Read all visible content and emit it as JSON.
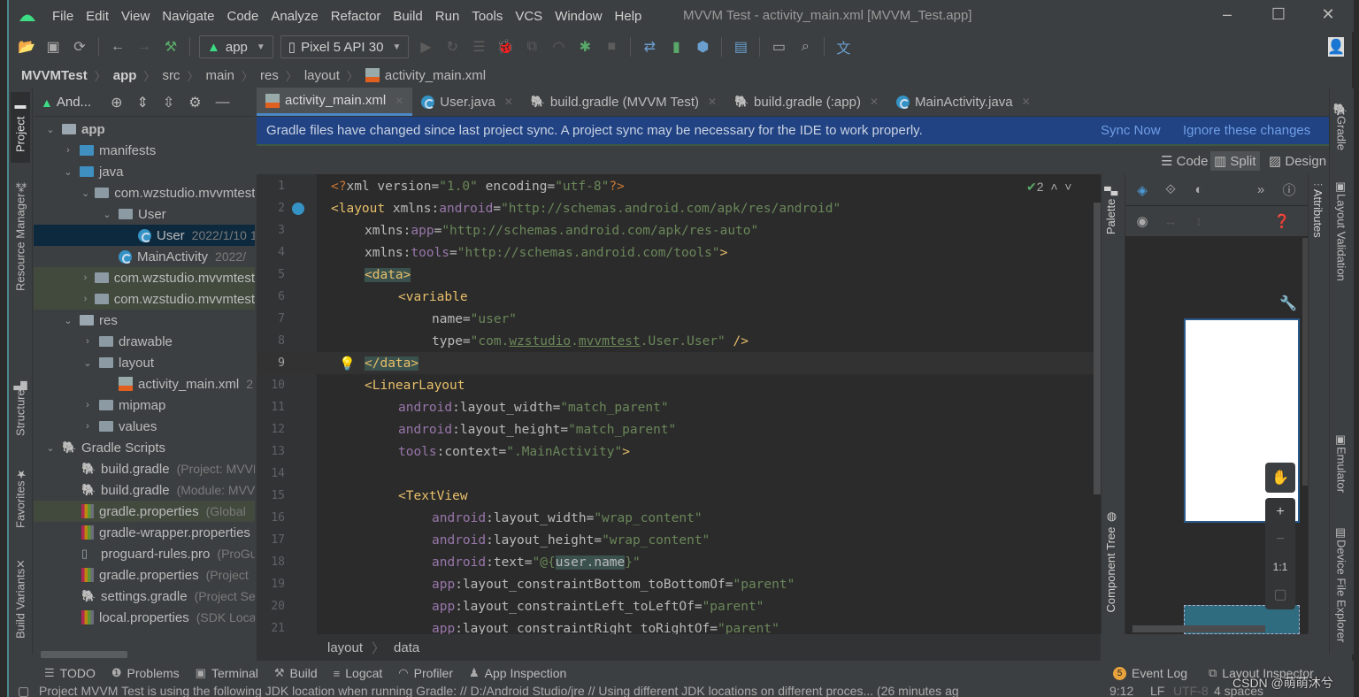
{
  "menu": {
    "items": [
      "File",
      "Edit",
      "View",
      "Navigate",
      "Code",
      "Analyze",
      "Refactor",
      "Build",
      "Run",
      "Tools",
      "VCS",
      "Window",
      "Help"
    ],
    "window_title": "MVVM Test - activity_main.xml [MVVM_Test.app]"
  },
  "window_controls": {
    "minimize": "–",
    "maximize": "☐",
    "close": "✕"
  },
  "toolbar": {
    "run_config": "app",
    "device": "Pixel 5 API 30"
  },
  "breadcrumb": [
    "MVVMTest",
    "app",
    "src",
    "main",
    "res",
    "layout",
    "activity_main.xml"
  ],
  "left_stripe": [
    "Project",
    "Resource Manager",
    "Structure",
    "Favorites",
    "Build Variants"
  ],
  "right_stripe": [
    "Gradle",
    "Layout Validation",
    "Emulator",
    "Device File Explorer"
  ],
  "project": {
    "view_mode": "And...",
    "tree": [
      {
        "label": "app",
        "meta": ""
      },
      {
        "label": "manifests",
        "meta": ""
      },
      {
        "label": "java",
        "meta": ""
      },
      {
        "label": "com.wzstudio.mvvmtest",
        "meta": ""
      },
      {
        "label": "User",
        "meta": ""
      },
      {
        "label": "User",
        "meta": "2022/1/10 1"
      },
      {
        "label": "MainActivity",
        "meta": "2022/"
      },
      {
        "label": "com.wzstudio.mvvmtest",
        "meta": ""
      },
      {
        "label": "com.wzstudio.mvvmtest",
        "meta": ""
      },
      {
        "label": "res",
        "meta": ""
      },
      {
        "label": "drawable",
        "meta": ""
      },
      {
        "label": "layout",
        "meta": ""
      },
      {
        "label": "activity_main.xml",
        "meta": "2"
      },
      {
        "label": "mipmap",
        "meta": ""
      },
      {
        "label": "values",
        "meta": ""
      },
      {
        "label": "Gradle Scripts",
        "meta": ""
      },
      {
        "label": "build.gradle",
        "meta": "(Project: MVVM"
      },
      {
        "label": "build.gradle",
        "meta": "(Module: MVVM"
      },
      {
        "label": "gradle.properties",
        "meta": "(Global"
      },
      {
        "label": "gradle-wrapper.properties",
        "meta": ""
      },
      {
        "label": "proguard-rules.pro",
        "meta": "(ProGuard"
      },
      {
        "label": "gradle.properties",
        "meta": "(Project"
      },
      {
        "label": "settings.gradle",
        "meta": "(Project Se"
      },
      {
        "label": "local.properties",
        "meta": "(SDK Loca"
      }
    ]
  },
  "tabs": [
    {
      "label": "activity_main.xml",
      "active": true
    },
    {
      "label": "User.java"
    },
    {
      "label": "build.gradle (MVVM Test)"
    },
    {
      "label": "build.gradle (:app)"
    },
    {
      "label": "MainActivity.java"
    }
  ],
  "banner": {
    "message": "Gradle files have changed since last project sync. A project sync may be necessary for the IDE to work properly.",
    "sync_now": "Sync Now",
    "ignore": "Ignore these changes"
  },
  "view_modes": {
    "code": "Code",
    "split": "Split",
    "design": "Design"
  },
  "inspection": {
    "count": "2"
  },
  "code": {
    "current_line": 9,
    "lines": [
      "1",
      "2",
      "3",
      "4",
      "5",
      "6",
      "7",
      "8",
      "9",
      "10",
      "11",
      "12",
      "13",
      "14",
      "15",
      "16",
      "17",
      "18",
      "19",
      "20",
      "21"
    ],
    "l1": {
      "a": "<?",
      "b": "xml version=",
      "c": "\"1.0\"",
      "d": " encoding=",
      "e": "\"utf-8\"",
      "f": "?>"
    },
    "l2": {
      "a": "<layout ",
      "b": "xmlns:",
      "c": "android",
      "d": "=",
      "e": "\"http://schemas.android.com/apk/res/android\""
    },
    "l3": {
      "b": "xmlns:",
      "c": "app",
      "d": "=",
      "e": "\"http://schemas.android.com/apk/res-auto\""
    },
    "l4": {
      "b": "xmlns:",
      "c": "tools",
      "d": "=",
      "e": "\"http://schemas.android.com/tools\"",
      "f": ">"
    },
    "l5": {
      "a": "<data>"
    },
    "l6": {
      "a": "<variable"
    },
    "l7": {
      "b": "name=",
      "e": "\"user\""
    },
    "l8": {
      "b": "type=",
      "e1": "\"com.",
      "u1": "wzstudio",
      "e2": ".",
      "u2": "mvvmtest",
      "e3": ".User.User\"",
      "f": " />"
    },
    "l9": {
      "a": "</data>"
    },
    "l10": {
      "a": "<LinearLayout"
    },
    "l11": {
      "c": "android",
      "b": ":layout_width=",
      "e": "\"match_parent\""
    },
    "l12": {
      "c": "android",
      "b": ":layout_height=",
      "e": "\"match_parent\""
    },
    "l13": {
      "c": "tools",
      "b": ":context=",
      "e": "\".MainActivity\"",
      "f": ">"
    },
    "l15": {
      "a": "<TextView"
    },
    "l16": {
      "c": "android",
      "b": ":layout_width=",
      "e": "\"wrap_content\""
    },
    "l17": {
      "c": "android",
      "b": ":layout_height=",
      "e": "\"wrap_content\""
    },
    "l18": {
      "c": "android",
      "b": ":text=",
      "e1": "\"@{",
      "h": "user.name",
      "e2": "}\""
    },
    "l19": {
      "c": "app",
      "b": ":layout_constraintBottom_toBottomOf=",
      "e": "\"parent\""
    },
    "l20": {
      "c": "app",
      "b": ":layout_constraintLeft_toLeftOf=",
      "e": "\"parent\""
    },
    "l21": {
      "c": "app",
      "b": ":layout_constraintRight_toRightOf=",
      "e": "\"parent\""
    }
  },
  "code_breadcrumb": [
    "layout",
    "data"
  ],
  "design": {
    "palette_label": "Palette",
    "component_tree_label": "Component Tree",
    "attributes_label": "Attributes",
    "zoom_reset": "1:1"
  },
  "tool_windows": [
    "TODO",
    "Problems",
    "Terminal",
    "Build",
    "Logcat",
    "Profiler",
    "App Inspection"
  ],
  "tool_windows_right": [
    {
      "label": "Event Log",
      "badge": "5"
    },
    {
      "label": "Layout Inspector"
    }
  ],
  "status": {
    "message": "Project MVVM Test is using the following JDK location when running Gradle: // D:/Android Studio/jre // Using different JDK locations on different proces... (26 minutes ag",
    "position": "9:12",
    "line_sep": "LF",
    "encoding": "UTF-8",
    "indent": "4 spaces"
  },
  "watermark": "CSDN @萌萌沐兮"
}
